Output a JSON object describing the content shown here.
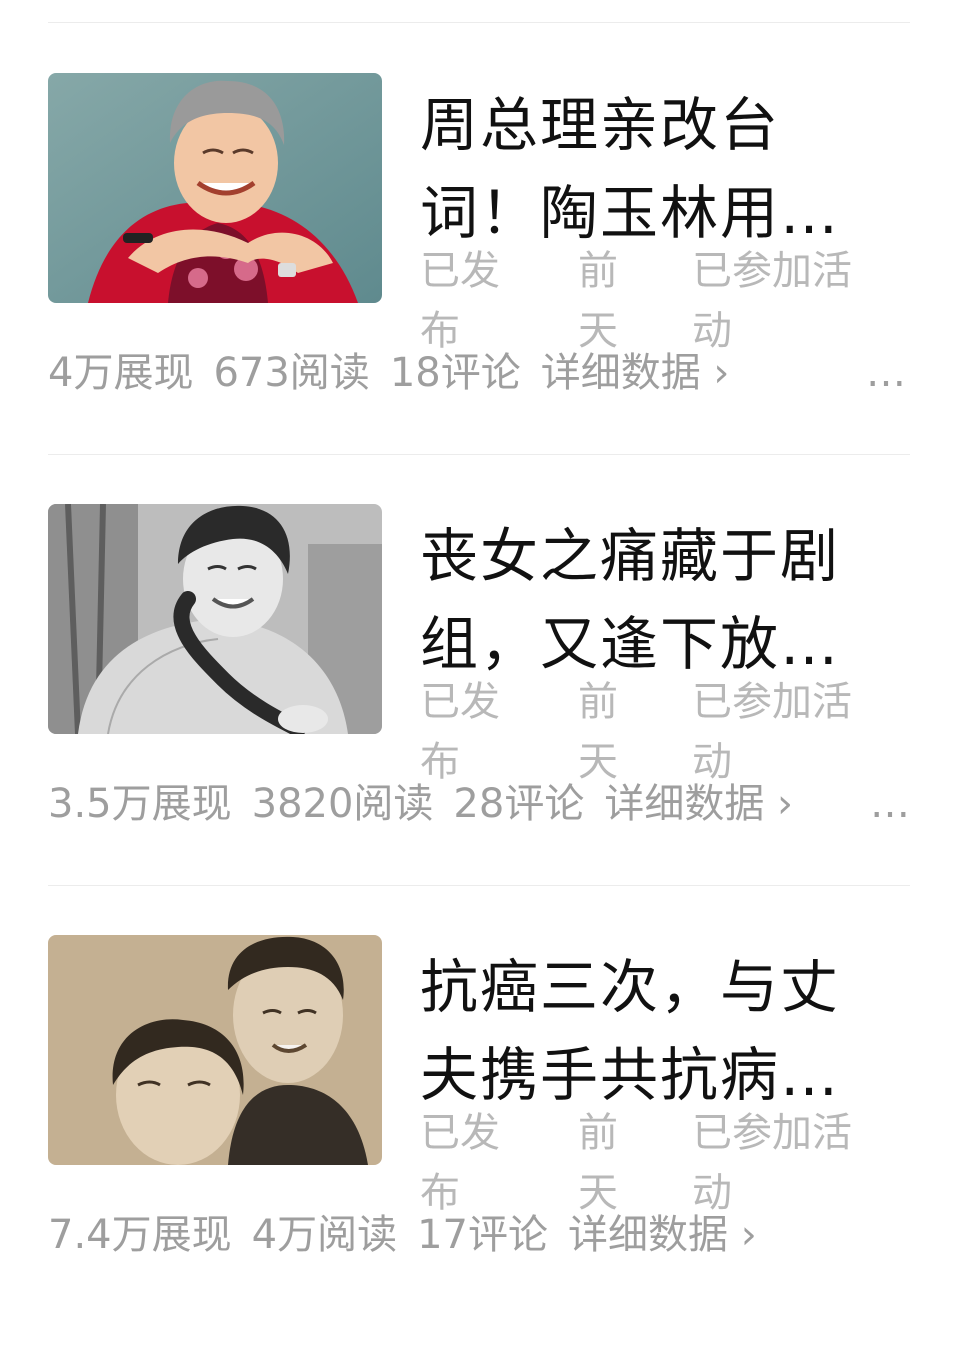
{
  "items": [
    {
      "title_line1": "周总理亲改台",
      "title_line2": "词！陶玉林用…",
      "meta": {
        "a1": "已发",
        "a2": "布",
        "b1": "前",
        "b2": "天",
        "c1": "已参加活",
        "c2": "动"
      },
      "stats": {
        "views": "4万展现",
        "reads": "673阅读",
        "comments": "18评论",
        "detail": "详细数据 ›"
      },
      "more": "…"
    },
    {
      "title_line1": "丧女之痛藏于剧",
      "title_line2": "组，又逢下放…",
      "meta": {
        "a1": "已发",
        "a2": "布",
        "b1": "前",
        "b2": "天",
        "c1": "已参加活",
        "c2": "动"
      },
      "stats": {
        "views": "3.5万展现",
        "reads": "3820阅读",
        "comments": "28评论",
        "detail": "详细数据 ›"
      },
      "more": "…"
    },
    {
      "title_line1": "抗癌三次，与丈",
      "title_line2": "夫携手共抗病…",
      "meta": {
        "a1": "已发",
        "a2": "布",
        "b1": "前",
        "b2": "天",
        "c1": "已参加活",
        "c2": "动"
      },
      "stats": {
        "views": "7.4万展现",
        "reads": "4万阅读",
        "comments": "17评论",
        "detail": "详细数据 ›"
      },
      "more": ""
    }
  ]
}
